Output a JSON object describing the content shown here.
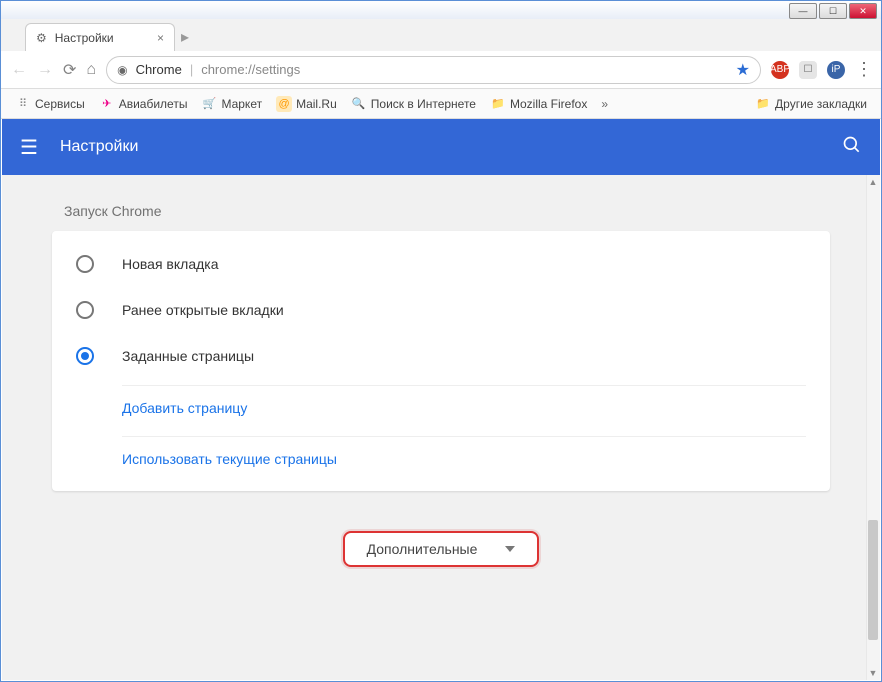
{
  "tab": {
    "title": "Настройки"
  },
  "omnibox": {
    "protocol_label": "Chrome",
    "url": "chrome://settings"
  },
  "bookmarks": {
    "items": [
      {
        "label": "Сервисы",
        "icon": "⋮⋮⋮"
      },
      {
        "label": "Авиабилеты",
        "icon": "✈"
      },
      {
        "label": "Маркет",
        "icon": "🛒"
      },
      {
        "label": "Mail.Ru",
        "icon": "@"
      },
      {
        "label": "Поиск в Интернете",
        "icon": "🔍"
      },
      {
        "label": "Mozilla Firefox",
        "icon": "📁"
      }
    ],
    "more": "»",
    "other": "Другие закладки"
  },
  "header": {
    "title": "Настройки"
  },
  "section": {
    "title": "Запуск Chrome",
    "options": [
      {
        "label": "Новая вкладка",
        "checked": false
      },
      {
        "label": "Ранее открытые вкладки",
        "checked": false
      },
      {
        "label": "Заданные страницы",
        "checked": true
      }
    ],
    "links": [
      "Добавить страницу",
      "Использовать текущие страницы"
    ]
  },
  "advanced_button": "Дополнительные"
}
